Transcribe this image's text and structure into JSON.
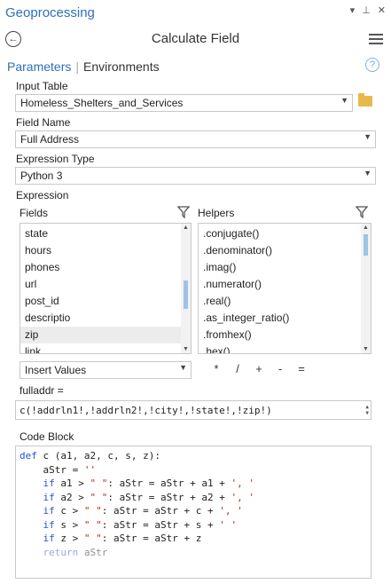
{
  "window": {
    "title": "Geoprocessing",
    "controls": [
      "▾",
      "⊥",
      "✕"
    ]
  },
  "header": {
    "tool_title": "Calculate Field"
  },
  "tabs": {
    "parameters": "Parameters",
    "separator": "|",
    "environments": "Environments"
  },
  "help": {
    "glyph": "?"
  },
  "input_table": {
    "label": "Input Table",
    "value": "Homeless_Shelters_and_Services"
  },
  "field_name": {
    "label": "Field Name",
    "value": "Full Address"
  },
  "expression_type": {
    "label": "Expression Type",
    "value": "Python 3"
  },
  "expression": {
    "label": "Expression",
    "fields_label": "Fields",
    "helpers_label": "Helpers",
    "fields": [
      "state",
      "hours",
      "phones",
      "url",
      "post_id",
      "descriptio",
      "zip",
      "link"
    ],
    "selected_field": "zip",
    "helpers": [
      ".conjugate()",
      ".denominator()",
      ".imag()",
      ".numerator()",
      ".real()",
      ".as_integer_ratio()",
      ".fromhex()",
      ".hex()"
    ],
    "insert_values": "Insert Values",
    "operators": [
      "*",
      "/",
      "+",
      "-",
      "="
    ]
  },
  "target": {
    "label": "fulladdr =",
    "expression_value": "c(!addrln1!,!addrln2!,!city!,!state!,!zip!)"
  },
  "code_block": {
    "label": "Code Block",
    "lines": [
      [
        {
          "t": "def",
          "c": "kw"
        },
        {
          "t": " c (a1, a2, c, s, z):",
          "c": ""
        }
      ],
      [
        {
          "t": "    aStr = ",
          "c": ""
        },
        {
          "t": "''",
          "c": "str"
        }
      ],
      [
        {
          "t": "    ",
          "c": ""
        },
        {
          "t": "if",
          "c": "kw"
        },
        {
          "t": " a1 > ",
          "c": ""
        },
        {
          "t": "\" \"",
          "c": "str"
        },
        {
          "t": ": aStr = aStr + a1 + ",
          "c": ""
        },
        {
          "t": "', '",
          "c": "str"
        }
      ],
      [
        {
          "t": "    ",
          "c": ""
        },
        {
          "t": "if",
          "c": "kw"
        },
        {
          "t": " a2 > ",
          "c": ""
        },
        {
          "t": "\" \"",
          "c": "str"
        },
        {
          "t": ": aStr = aStr + a2 + ",
          "c": ""
        },
        {
          "t": "', '",
          "c": "str"
        }
      ],
      [
        {
          "t": "    ",
          "c": ""
        },
        {
          "t": "if",
          "c": "kw"
        },
        {
          "t": " c > ",
          "c": ""
        },
        {
          "t": "\" \"",
          "c": "str"
        },
        {
          "t": ": aStr = aStr + c + ",
          "c": ""
        },
        {
          "t": "', '",
          "c": "str"
        }
      ],
      [
        {
          "t": "    ",
          "c": ""
        },
        {
          "t": "if",
          "c": "kw"
        },
        {
          "t": " s > ",
          "c": ""
        },
        {
          "t": "\" \"",
          "c": "str"
        },
        {
          "t": ": aStr = aStr + s + ",
          "c": ""
        },
        {
          "t": "' '",
          "c": "str"
        }
      ],
      [
        {
          "t": "    ",
          "c": ""
        },
        {
          "t": "if",
          "c": "kw"
        },
        {
          "t": " z > ",
          "c": ""
        },
        {
          "t": "\" \"",
          "c": "str"
        },
        {
          "t": ": aStr = aStr + z",
          "c": ""
        }
      ],
      [
        {
          "t": "    ",
          "c": ""
        },
        {
          "t": "return",
          "c": "kw"
        },
        {
          "t": " aStr",
          "c": ""
        }
      ]
    ]
  },
  "colors": {
    "accent": "#2e6fb7",
    "keyword": "#2a4fd8",
    "string": "#c8201e"
  }
}
